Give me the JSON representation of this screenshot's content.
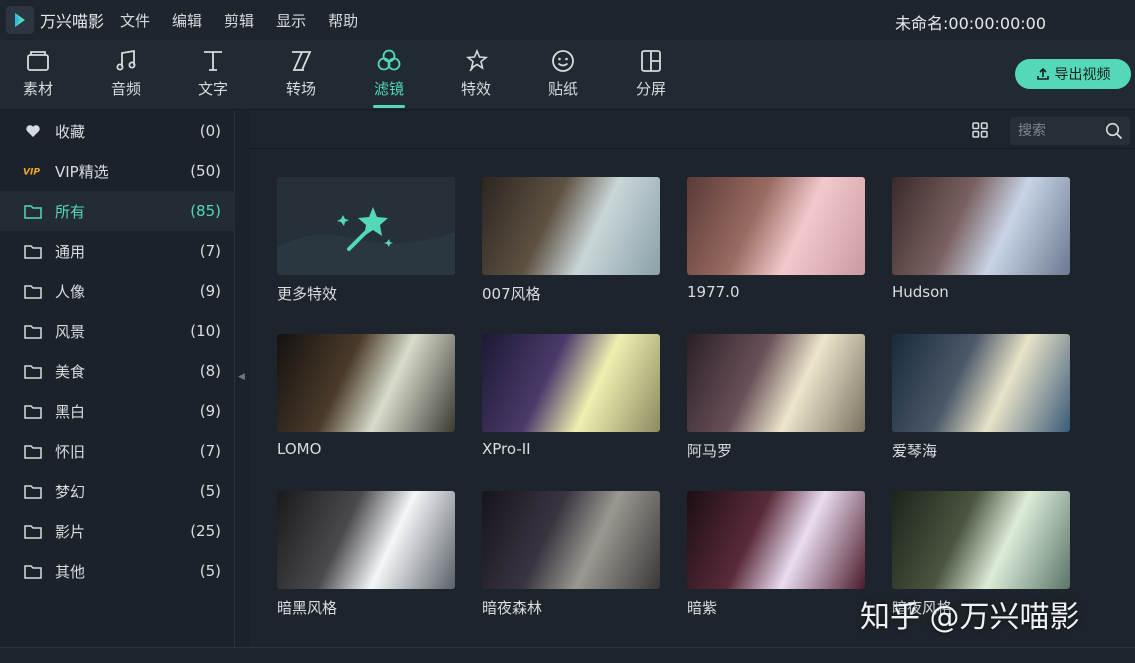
{
  "app": {
    "name": "万兴喵影",
    "project_title": "未命名:00:00:00:00"
  },
  "menu": [
    "文件",
    "编辑",
    "剪辑",
    "显示",
    "帮助"
  ],
  "toolbar": {
    "tabs": [
      {
        "label": "素材",
        "icon": "folder-icon"
      },
      {
        "label": "音频",
        "icon": "music-icon"
      },
      {
        "label": "文字",
        "icon": "text-icon"
      },
      {
        "label": "转场",
        "icon": "transition-icon"
      },
      {
        "label": "滤镜",
        "icon": "filter-icon",
        "active": true
      },
      {
        "label": "特效",
        "icon": "effects-icon"
      },
      {
        "label": "贴纸",
        "icon": "sticker-icon"
      },
      {
        "label": "分屏",
        "icon": "split-screen-icon"
      }
    ],
    "export_label": "导出视频",
    "accent": "#52d9b8"
  },
  "sidebar": {
    "items": [
      {
        "label": "收藏",
        "count": "(0)",
        "icon": "heart-icon"
      },
      {
        "label": "VIP精选",
        "count": "(50)",
        "icon": "vip-icon"
      },
      {
        "label": "所有",
        "count": "(85)",
        "icon": "folder-icon",
        "active": true
      },
      {
        "label": "通用",
        "count": "(7)",
        "icon": "folder-icon"
      },
      {
        "label": "人像",
        "count": "(9)",
        "icon": "folder-icon"
      },
      {
        "label": "风景",
        "count": "(10)",
        "icon": "folder-icon"
      },
      {
        "label": "美食",
        "count": "(8)",
        "icon": "folder-icon"
      },
      {
        "label": "黑白",
        "count": "(9)",
        "icon": "folder-icon"
      },
      {
        "label": "怀旧",
        "count": "(7)",
        "icon": "folder-icon"
      },
      {
        "label": "梦幻",
        "count": "(5)",
        "icon": "folder-icon"
      },
      {
        "label": "影片",
        "count": "(25)",
        "icon": "folder-icon"
      },
      {
        "label": "其他",
        "count": "(5)",
        "icon": "folder-icon"
      }
    ]
  },
  "search": {
    "placeholder": "搜索"
  },
  "filters": [
    {
      "label": "更多特效"
    },
    {
      "label": "007风格"
    },
    {
      "label": "1977.0"
    },
    {
      "label": "Hudson"
    },
    {
      "label": "LOMO"
    },
    {
      "label": "XPro-II"
    },
    {
      "label": "阿马罗"
    },
    {
      "label": "爱琴海"
    },
    {
      "label": "暗黑风格"
    },
    {
      "label": "暗夜森林"
    },
    {
      "label": "暗紫"
    },
    {
      "label": "暗夜风格"
    }
  ],
  "watermark": "知乎 @万兴喵影"
}
